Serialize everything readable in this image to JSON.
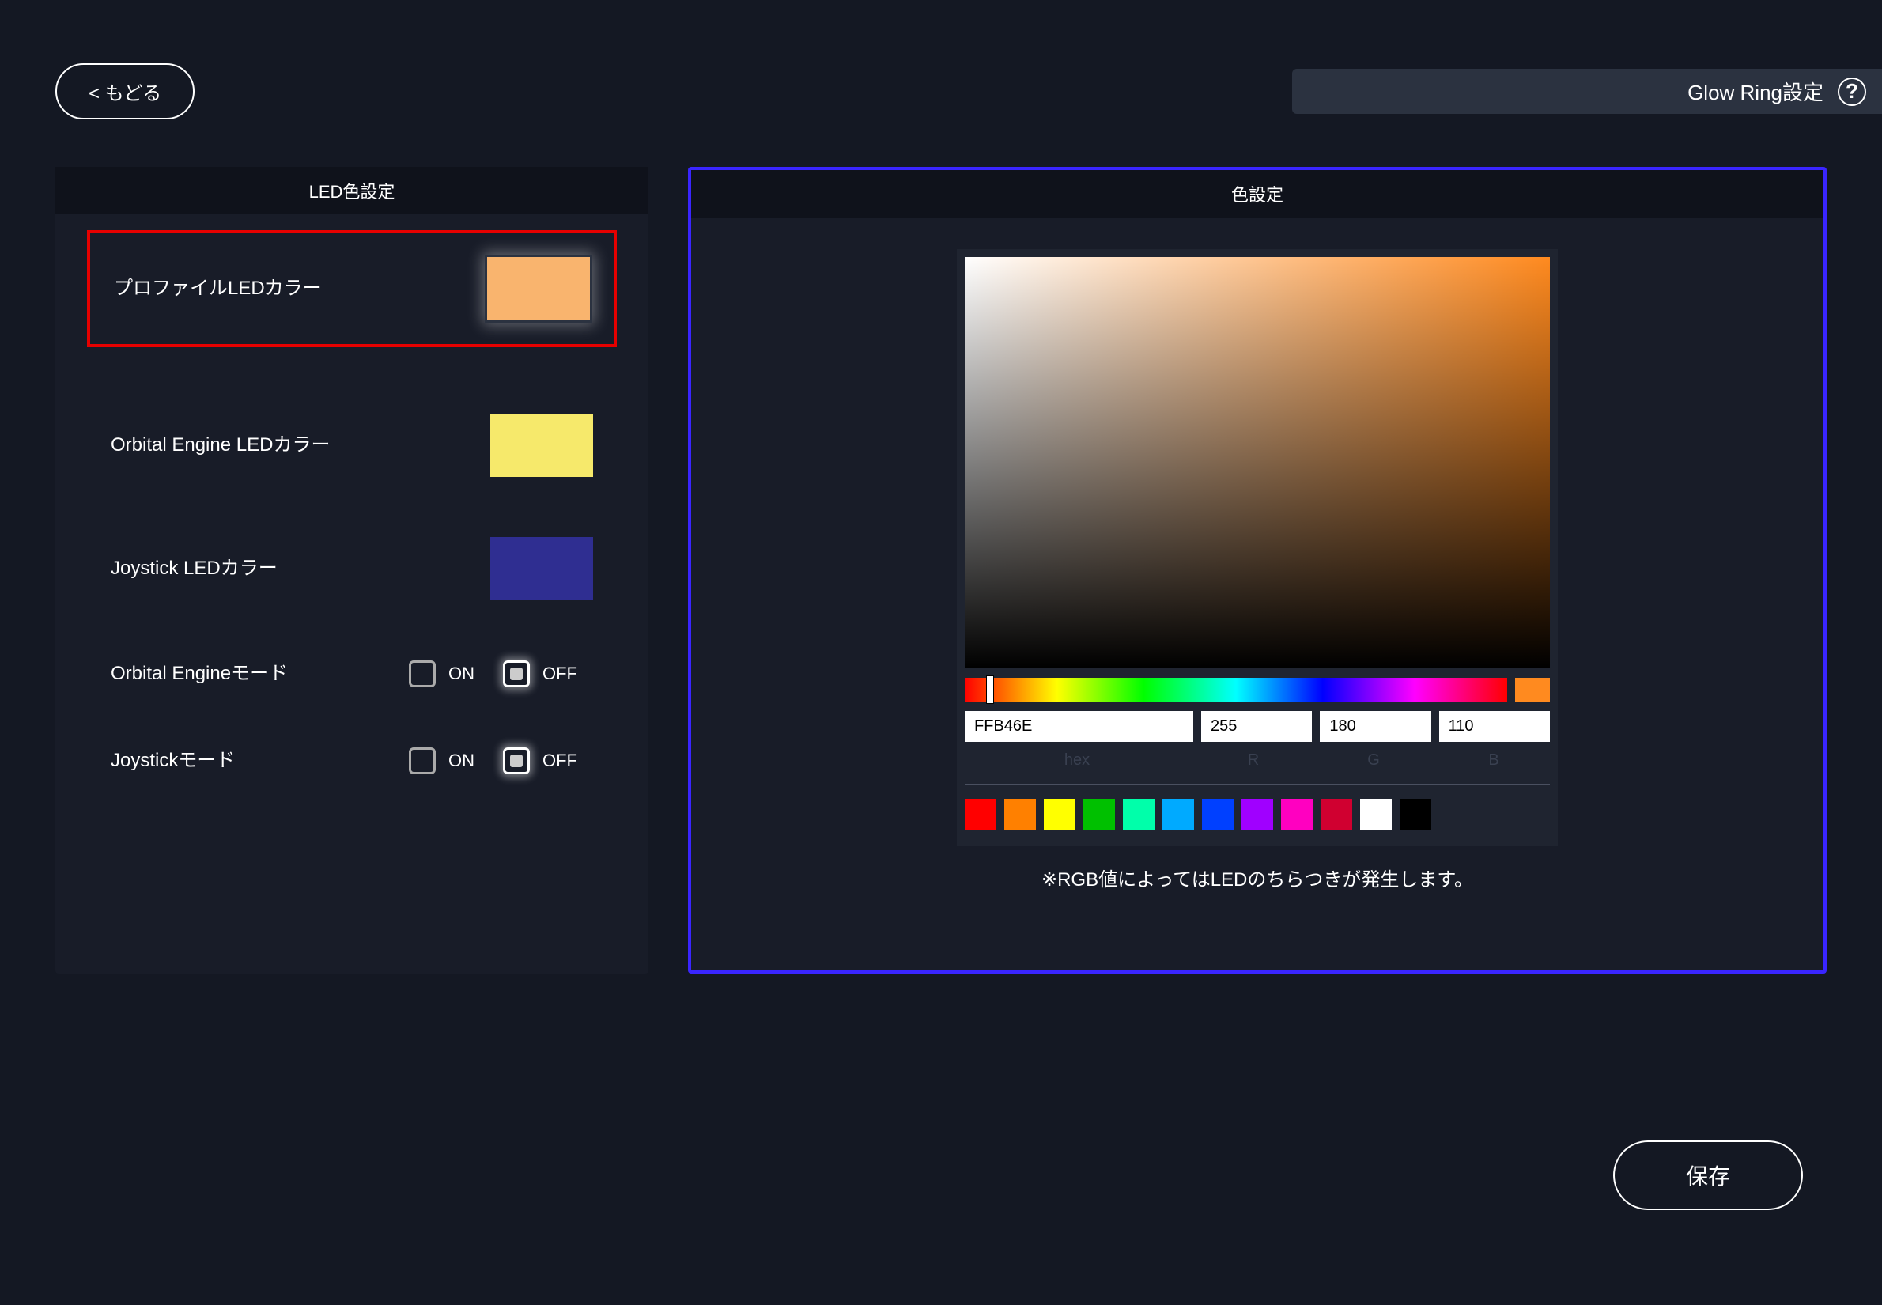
{
  "topbar": {
    "back_label": "< もどる",
    "page_title": "Glow Ring設定",
    "help_glyph": "?"
  },
  "left_panel": {
    "header": "LED色設定",
    "rows": [
      {
        "label": "プロファイルLEDカラー",
        "color": "#f9b46e",
        "selected": true
      },
      {
        "label": "Orbital Engine LEDカラー",
        "color": "#f6e96b",
        "selected": false
      },
      {
        "label": "Joystick LEDカラー",
        "color": "#2f2e91",
        "selected": false
      }
    ],
    "modes": [
      {
        "label": "Orbital Engineモード",
        "on_label": "ON",
        "off_label": "OFF",
        "value": "off"
      },
      {
        "label": "Joystickモード",
        "on_label": "ON",
        "off_label": "OFF",
        "value": "off"
      }
    ]
  },
  "right_panel": {
    "header": "色設定",
    "base_hue_color": "#ff8a1f",
    "hex": "FFB46E",
    "r": "255",
    "g": "180",
    "b": "110",
    "field_labels": {
      "hex": "hex",
      "r": "R",
      "g": "G",
      "b": "B"
    },
    "presets": [
      "#ff0000",
      "#ff8000",
      "#ffff00",
      "#00c000",
      "#00ffaa",
      "#00aaff",
      "#0040ff",
      "#a000ff",
      "#ff00c0",
      "#d00030",
      "#ffffff",
      "#000000"
    ],
    "note": "※RGB値によってはLEDのちらつきが発生します。"
  },
  "save_label": "保存"
}
